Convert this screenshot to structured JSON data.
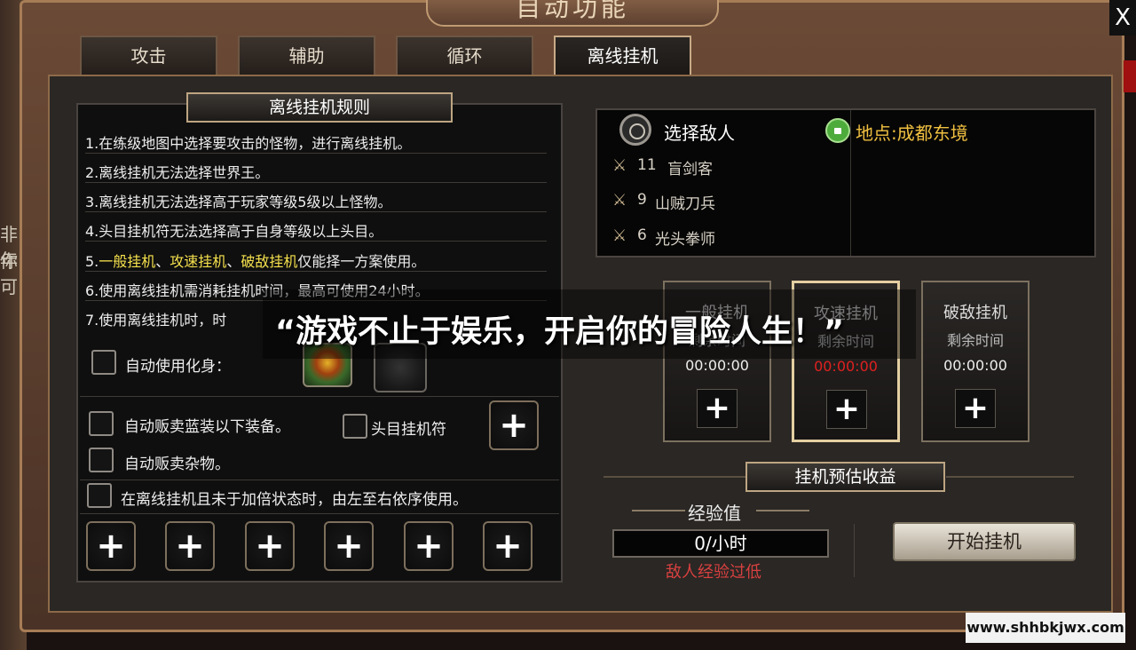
{
  "window": {
    "title": "自动功能",
    "close_label": "X"
  },
  "tabs": [
    {
      "label": "攻击"
    },
    {
      "label": "辅助"
    },
    {
      "label": "循环"
    },
    {
      "label": "离线挂机"
    }
  ],
  "background": {
    "left_text": [
      "非年",
      "你可"
    ]
  },
  "rules": {
    "header": "离线挂机规则",
    "items": [
      "1.在练级地图中选择要攻击的怪物，进行离线挂机。",
      "2.离线挂机无法选择世界王。",
      "3.离线挂机无法选择高于玩家等级5级以上怪物。",
      "4.头目挂机符无法选择高于自身等级以上头目。",
      {
        "prefix": "5.",
        "h1": "一般挂机",
        "sep1": "、",
        "h2": "攻速挂机",
        "sep2": "、",
        "h3": "破敌挂机",
        "suffix": "仅能择一方案使用。"
      },
      "6.使用离线挂机需消耗挂机时间，最高可使用24小时。",
      "7.使用离线挂机时，时"
    ]
  },
  "options": {
    "auto_transform": "自动使用化身：",
    "sell_blue": "自动贩卖蓝装以下装备。",
    "boss_charm": "头目挂机符",
    "sell_misc": "自动贩卖杂物。",
    "double_status": "在离线挂机且未于加倍状态时，由左至右依序使用。",
    "plus": "+"
  },
  "enemy": {
    "select_label": "选择敌人",
    "location": "地点:成都东境",
    "list": [
      {
        "level": "11",
        "name": "盲剑客"
      },
      {
        "level": "9",
        "name": "山贼刀兵"
      },
      {
        "level": "6",
        "name": "光头拳师"
      }
    ]
  },
  "modes": [
    {
      "name": "一般挂机",
      "sub": "剩余时间",
      "time": "00:00:00"
    },
    {
      "name": "攻速挂机",
      "sub": "剩余时间",
      "time": "00:00:00"
    },
    {
      "name": "破敌挂机",
      "sub": "剩余时间",
      "time": "00:00:00"
    }
  ],
  "income": {
    "header": "挂机预估收益",
    "exp_label": "经验值",
    "exp_value": "0/小时",
    "warning": "敌人经验过低",
    "start_button": "开始挂机"
  },
  "overlay": {
    "slogan": "“游戏不止于娱乐，开启你的冒险人生！”"
  },
  "watermark": {
    "text": "www.shhbkjwx.com"
  },
  "colors": {
    "highlight": "#f4e04c",
    "warning": "#d84040",
    "location": "#f0c040",
    "timer_red": "#e02020"
  }
}
